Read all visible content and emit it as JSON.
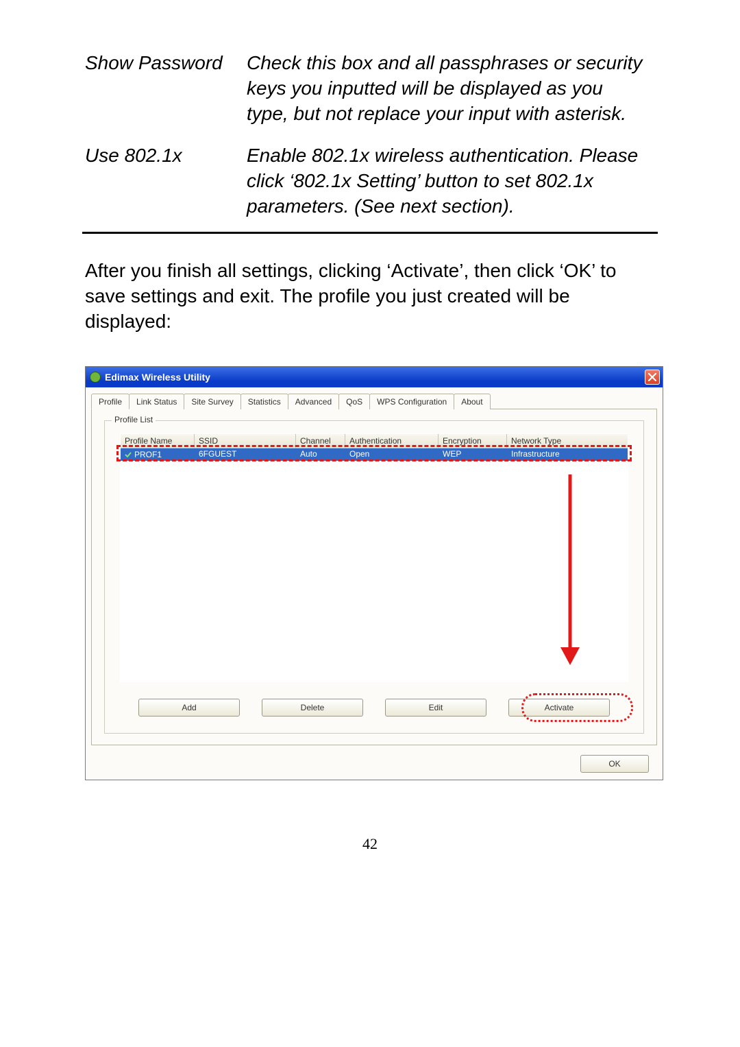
{
  "definitions": [
    {
      "term": "Show Password",
      "desc": "Check this box and all passphrases or security keys you inputted will be displayed as you type, but not replace your input with asterisk."
    },
    {
      "term": "Use 802.1x",
      "desc": "Enable 802.1x wireless authentication. Please click ‘802.1x Setting’ button to set 802.1x parameters. (See next section)."
    }
  ],
  "body_paragraph": "After you finish all settings, clicking ‘Activate’, then click ‘OK’ to save settings and exit. The profile you just created will be displayed:",
  "window": {
    "title": "Edimax Wireless Utility",
    "tabs": [
      "Profile",
      "Link Status",
      "Site Survey",
      "Statistics",
      "Advanced",
      "QoS",
      "WPS Configuration",
      "About"
    ],
    "active_tab": "Profile",
    "group_title": "Profile List",
    "columns": {
      "name": "Profile Name",
      "ssid": "SSID",
      "channel": "Channel",
      "auth": "Authentication",
      "encryption": "Encryption",
      "ntype": "Network Type"
    },
    "row": {
      "name": "PROF1",
      "ssid": "6FGUEST",
      "channel": "Auto",
      "auth": "Open",
      "encryption": "WEP",
      "ntype": "Infrastructure"
    },
    "buttons": {
      "add": "Add",
      "delete": "Delete",
      "edit": "Edit",
      "activate": "Activate",
      "ok": "OK"
    }
  },
  "page_number": "42"
}
